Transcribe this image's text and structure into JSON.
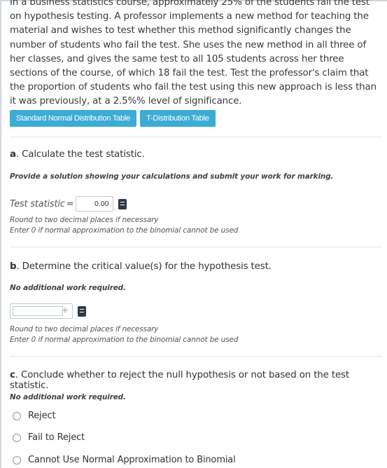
{
  "problem_text": "In a business statistics course, approximately 25% of the students fail the test on hypothesis testing. A professor implements a new method for teaching the material and wishes to test whether this method significantly changes the number of students who fail the test. She uses the new method in all three of her classes, and gives the same test to all 105 students across her three sections of the course, of which 18 fail the test. Test the professor's claim that the proportion of students who fail the test using this new approach is less than it was previously, at a 2.5%% level of significance.",
  "buttons": {
    "normal_table": "Standard Normal Distribution Table",
    "t_table": "T-Distribution Table"
  },
  "part_a": {
    "letter": "a",
    "question": ". Calculate the test statistic.",
    "instruction": "Provide a solution showing your calculations and submit your work for marking.",
    "label": "Test statistic",
    "equals": "=",
    "value": "0.00",
    "note1": "Round to two decimal places if necessary",
    "note2": "Enter 0 if normal approximation to the binomial cannot be used"
  },
  "part_b": {
    "letter": "b",
    "question": ". Determine the critical value(s) for the hypothesis test.",
    "instruction": "No additional work required.",
    "plus": "+",
    "note1": "Round to two decimal places if necessary",
    "note2": "Enter 0 if normal approximation to the binomial cannot be used"
  },
  "part_c": {
    "letter": "c",
    "question": ". Conclude whether to reject the null hypothesis or not based on the test statistic.",
    "instruction": "No additional work required.",
    "options": [
      "Reject",
      "Fail to Reject",
      "Cannot Use Normal Approximation to Binomial"
    ]
  },
  "colors": {
    "button_bg": "#3cacd6",
    "text": "#333333",
    "divider": "#e3e6ea"
  }
}
